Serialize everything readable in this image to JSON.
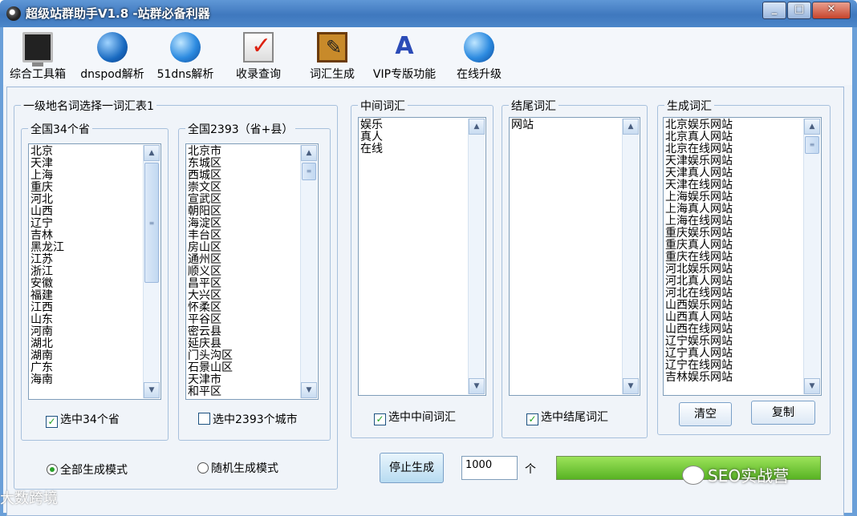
{
  "window": {
    "title": "超级站群助手V1.8 -站群必备利器",
    "minimize": "_",
    "maximize": "□",
    "close": "✕"
  },
  "toolbar": {
    "items": [
      {
        "label": "综合工具箱",
        "icon": "toolbox-monitor-icon"
      },
      {
        "label": "dnspod解析",
        "icon": "dnspod-globe-icon"
      },
      {
        "label": "51dns解析",
        "icon": "dns-ie-icon"
      },
      {
        "label": "收录查询",
        "icon": "check-screen-icon"
      },
      {
        "label": "词汇生成",
        "icon": "note-icon"
      },
      {
        "label": "VIP专版功能",
        "icon": "vip-aa-icon"
      },
      {
        "label": "在线升级",
        "icon": "upgrade-globe-icon"
      }
    ]
  },
  "group_region": {
    "legend": "一级地名词选择一词汇表1",
    "provinces": {
      "legend": "全国34个省",
      "items": [
        "北京",
        "天津",
        "上海",
        "重庆",
        "河北",
        "山西",
        "辽宁",
        "吉林",
        "黑龙江",
        "江苏",
        "浙江",
        "安徽",
        "福建",
        "江西",
        "山东",
        "河南",
        "湖北",
        "湖南",
        "广东",
        "海南"
      ],
      "check_label": "选中34个省",
      "checked": true
    },
    "cities": {
      "legend": "全国2393（省+县）",
      "items": [
        "北京市",
        "东城区",
        "西城区",
        "崇文区",
        "宣武区",
        "朝阳区",
        "海淀区",
        "丰台区",
        "房山区",
        "通州区",
        "顺义区",
        "昌平区",
        "大兴区",
        "怀柔区",
        "平谷区",
        "密云县",
        "延庆县",
        "门头沟区",
        "石景山区",
        "天津市",
        "和平区"
      ],
      "check_label": "选中2393个城市",
      "checked": false
    },
    "mode_all": "全部生成模式",
    "mode_random": "随机生成模式",
    "mode_selected": "all"
  },
  "group_middle": {
    "legend": "中间词汇",
    "items": [
      "娱乐",
      "真人",
      "在线"
    ],
    "check_label": "选中中间词汇",
    "checked": true
  },
  "group_end": {
    "legend": "结尾词汇",
    "items": [
      "网站"
    ],
    "check_label": "选中结尾词汇",
    "checked": true
  },
  "group_output": {
    "legend": "生成词汇",
    "items": [
      "北京娱乐网站",
      "北京真人网站",
      "北京在线网站",
      "天津娱乐网站",
      "天津真人网站",
      "天津在线网站",
      "上海娱乐网站",
      "上海真人网站",
      "上海在线网站",
      "重庆娱乐网站",
      "重庆真人网站",
      "重庆在线网站",
      "河北娱乐网站",
      "河北真人网站",
      "河北在线网站",
      "山西娱乐网站",
      "山西真人网站",
      "山西在线网站",
      "辽宁娱乐网站",
      "辽宁真人网站",
      "辽宁在线网站",
      "吉林娱乐网站"
    ],
    "clear_label": "清空",
    "copy_label": "复制"
  },
  "controls": {
    "stop_label": "停止生成",
    "count_value": "1000",
    "count_unit": "个",
    "progress": 1.0
  },
  "watermarks": {
    "left": "大数跨境",
    "right": "SEO实战营"
  }
}
